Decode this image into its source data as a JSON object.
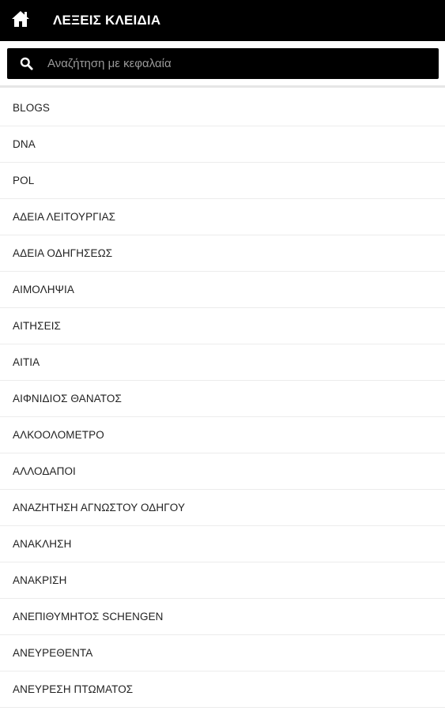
{
  "header": {
    "title": "ΛΕΞΕΙΣ ΚΛΕΙΔΙΑ",
    "home_icon": "home-icon"
  },
  "search": {
    "placeholder": "Αναζήτηση με κεφαλαία",
    "value": "",
    "icon": "search-icon"
  },
  "colors": {
    "bar_background": "#000000",
    "title_text": "#ffffff",
    "placeholder_text": "#9a9a9a",
    "item_text": "#222222",
    "divider": "#ececec"
  },
  "keywords": [
    "BLOGS",
    "DNA",
    "POL",
    "ΑΔΕΙΑ ΛΕΙΤΟΥΡΓΙΑΣ",
    "ΑΔΕΙΑ ΟΔΗΓΗΣΕΩΣ",
    "ΑΙΜΟΛΗΨΙΑ",
    "ΑΙΤΗΣΕΙΣ",
    "ΑΙΤΙΑ",
    "ΑΙΦΝΙΔΙΟΣ ΘΑΝΑΤΟΣ",
    "ΑΛΚΟΟΛΟΜΕΤΡΟ",
    "ΑΛΛΟΔΑΠΟΙ",
    "ΑΝΑΖΗΤΗΣΗ ΑΓΝΩΣΤΟΥ ΟΔΗΓΟΥ",
    "ΑΝΑΚΛΗΣΗ",
    "ΑΝΑΚΡΙΣΗ",
    "ΑΝΕΠΙΘΥΜΗΤΟΣ SCHENGEN",
    "ΑΝΕΥΡΕΘΕΝΤΑ",
    "ΑΝΕΥΡΕΣΗ ΠΤΩΜΑΤΟΣ"
  ]
}
